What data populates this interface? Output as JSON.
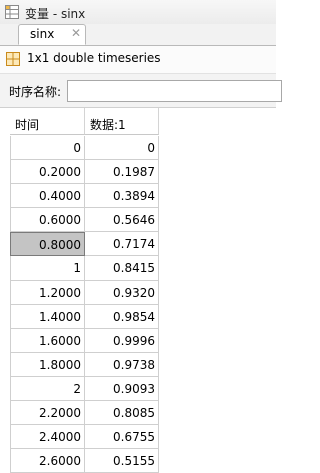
{
  "window": {
    "title": "变量 - sinx"
  },
  "tabs": [
    {
      "label": "sinx",
      "close_glyph": "✕"
    }
  ],
  "info": {
    "description": "1x1 double timeseries"
  },
  "field": {
    "label": "时序名称:",
    "value": ""
  },
  "table": {
    "headers": [
      "时间",
      "数据:1"
    ],
    "rows": [
      [
        "0",
        "0"
      ],
      [
        "0.2000",
        "0.1987"
      ],
      [
        "0.4000",
        "0.3894"
      ],
      [
        "0.6000",
        "0.5646"
      ],
      [
        "0.8000",
        "0.7174"
      ],
      [
        "1",
        "0.8415"
      ],
      [
        "1.2000",
        "0.9320"
      ],
      [
        "1.4000",
        "0.9854"
      ],
      [
        "1.6000",
        "0.9996"
      ],
      [
        "1.8000",
        "0.9738"
      ],
      [
        "2",
        "0.9093"
      ],
      [
        "2.2000",
        "0.8085"
      ],
      [
        "2.4000",
        "0.6755"
      ],
      [
        "2.6000",
        "0.5155"
      ]
    ],
    "selected_row": 4,
    "selected_col": 0
  },
  "icons": {
    "app": "variable-editor-icon",
    "grid": "grid-icon",
    "close": "close-icon"
  },
  "colors": {
    "selected_cell": "#c4c4c4",
    "grid_line": "#cfcfcf",
    "grid_icon": "#e8a33a"
  }
}
